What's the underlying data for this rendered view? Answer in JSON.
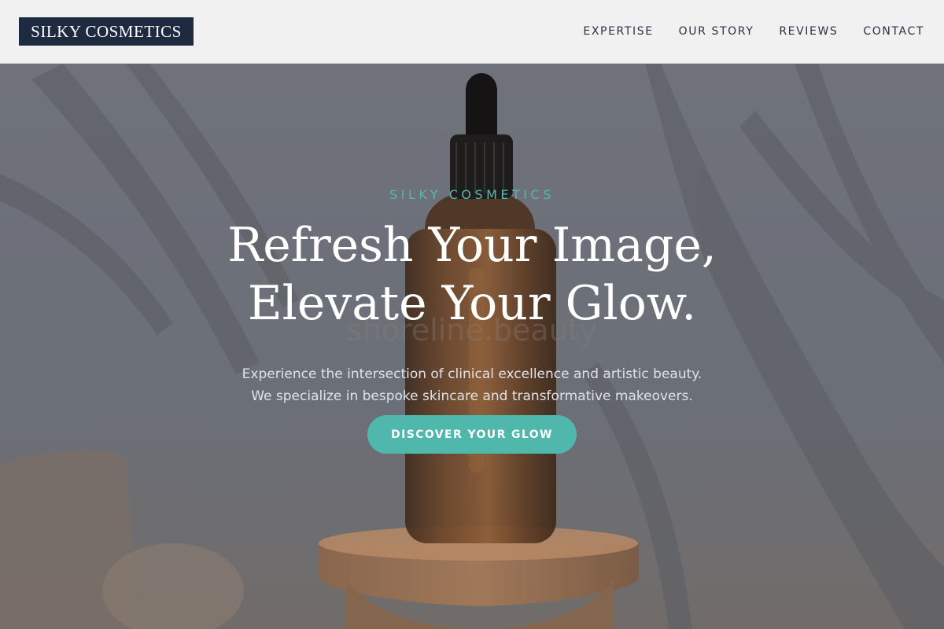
{
  "header": {
    "logo_text": "SILKY COSMETICS",
    "nav": [
      {
        "label": "EXPERTISE"
      },
      {
        "label": "OUR STORY"
      },
      {
        "label": "REVIEWS"
      },
      {
        "label": "CONTACT"
      }
    ]
  },
  "hero": {
    "eyebrow": "SILKY COSMETICS",
    "headline_lines": [
      "Refresh Your Image,",
      "Elevate Your Glow."
    ],
    "subcopy_lines": [
      "Experience the intersection of clinical excellence and artistic beauty.",
      "We specialize in bespoke skincare and transformative makeovers."
    ],
    "cta_label": "DISCOVER YOUR GLOW",
    "background_image": "amber-dropper-bottle-on-wooden-pedestal-with-leaf-shadows"
  },
  "colors": {
    "logo_bg": "#1e2a40",
    "header_bg": "#f1f1f2",
    "accent_teal": "#4fb7ac",
    "hero_overlay": "#6d7079",
    "nav_text": "#2b3140"
  }
}
